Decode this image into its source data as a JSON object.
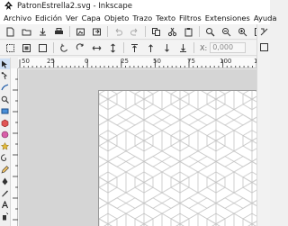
{
  "window": {
    "title": "PatronEstrella2.svg - Inkscape",
    "logo_icon": "inkscape-logo-icon"
  },
  "menubar": {
    "items": [
      "Archivo",
      "Edición",
      "Ver",
      "Capa",
      "Objeto",
      "Trazo",
      "Texto",
      "Filtros",
      "Extensiones",
      "Ayuda"
    ]
  },
  "toolbar_main": {
    "icons": [
      "new-document-icon",
      "open-icon",
      "save-icon",
      "print-icon",
      "import-icon",
      "export-icon",
      "undo-icon",
      "redo-icon",
      "copy-icon",
      "cut-icon",
      "paste-icon",
      "zoom-selection-icon",
      "zoom-drawing-icon",
      "zoom-page-icon",
      "duplicate-icon"
    ]
  },
  "toolbar_tool_controls": {
    "icons": [
      "select-all-icon",
      "select-all-layers-icon",
      "deselect-icon",
      "rotate-ccw-icon",
      "rotate-cw-icon",
      "flip-horizontal-icon",
      "flip-vertical-icon",
      "raise-to-top-icon",
      "raise-icon",
      "lower-icon",
      "lower-to-bottom-icon"
    ],
    "x_label": "X:",
    "x_value": "0,000"
  },
  "toolbox": {
    "tools": [
      "selector-tool-icon",
      "node-tool-icon",
      "tweak-tool-icon",
      "zoom-tool-icon",
      "rectangle-tool-icon",
      "3dbox-tool-icon",
      "ellipse-tool-icon",
      "star-tool-icon",
      "spiral-tool-icon",
      "pencil-tool-icon",
      "pen-tool-icon",
      "calligraphy-tool-icon",
      "text-tool-icon",
      "spray-tool-icon"
    ]
  },
  "ruler": {
    "labels": [
      "50",
      "25",
      "0",
      "25",
      "50",
      "75",
      "100",
      "125"
    ]
  },
  "colors": {
    "canvas_bg": "#d5d5d5",
    "page_bg": "#ffffff",
    "pattern_stroke": "#c4c4c4",
    "active_tool": "#cfe0f5"
  }
}
